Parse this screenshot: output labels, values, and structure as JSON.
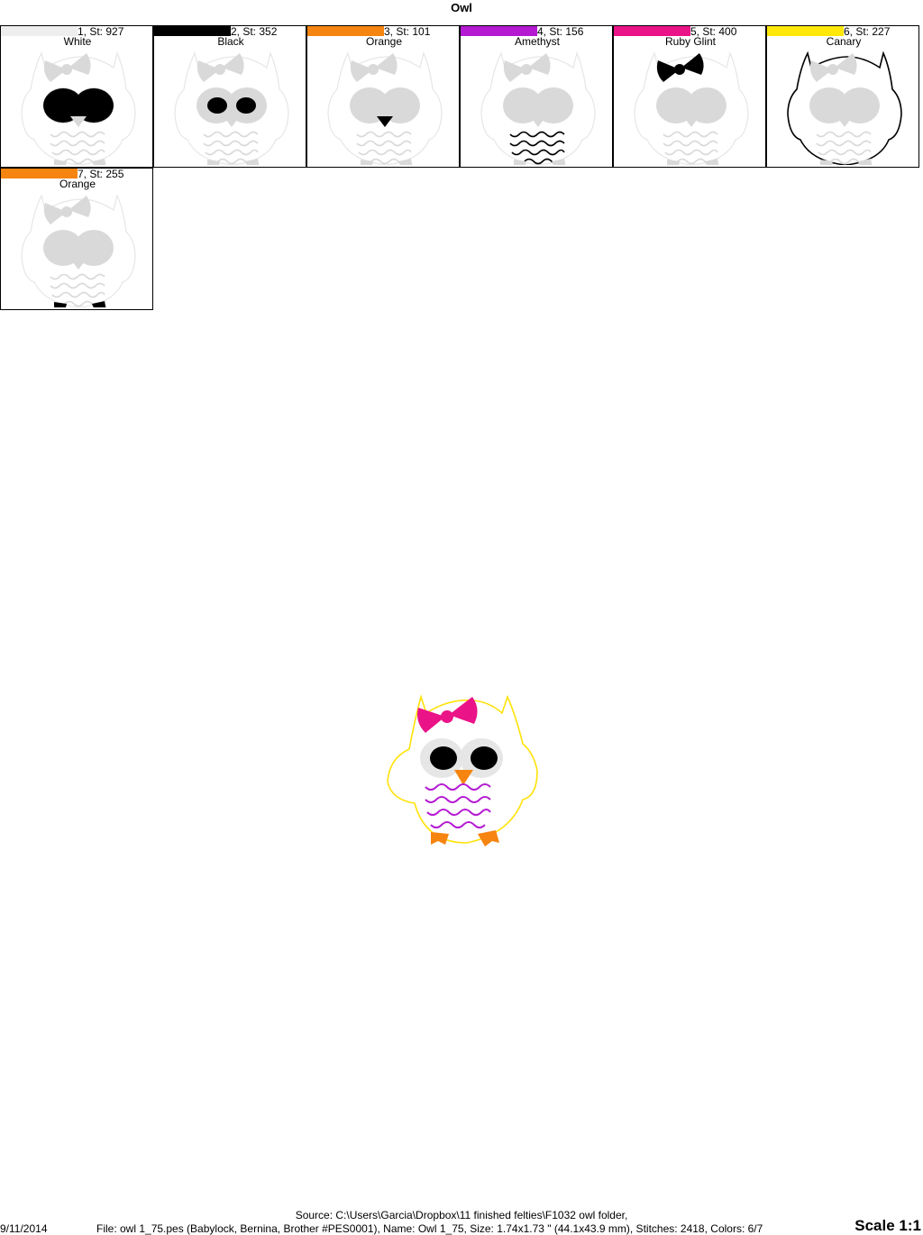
{
  "header": {
    "title": "Owl"
  },
  "thread_steps": [
    {
      "label": "1, St: 927",
      "name": "White",
      "color": "#eeeeee",
      "highlight": "white"
    },
    {
      "label": "2, St: 352",
      "name": "Black",
      "color": "#000000",
      "highlight": "black"
    },
    {
      "label": "3, St: 101",
      "name": "Orange",
      "color": "#f58410",
      "highlight": "orange"
    },
    {
      "label": "4, St: 156",
      "name": "Amethyst",
      "color": "#b41ad2",
      "highlight": "amethyst"
    },
    {
      "label": "5, St: 400",
      "name": "Ruby Glint",
      "color": "#ea1387",
      "highlight": "ruby"
    },
    {
      "label": "6, St: 227",
      "name": "Canary",
      "color": "#ffe80a",
      "highlight": "canary"
    },
    {
      "label": "7, St: 255",
      "name": "Orange",
      "color": "#f58410",
      "highlight": "feet"
    }
  ],
  "footer": {
    "source": "Source: C:\\Users\\Garcia\\Dropbox\\11 finished felties\\F1032 owl folder,",
    "date": "9/11/2014",
    "file_info": "File: owl 1_75.pes (Babylock, Bernina, Brother #PES0001), Name: Owl 1_75, Size: 1.74x1.73 \" (44.1x43.9 mm), Stitches: 2418, Colors: 6/7",
    "scale": "Scale 1:1"
  }
}
